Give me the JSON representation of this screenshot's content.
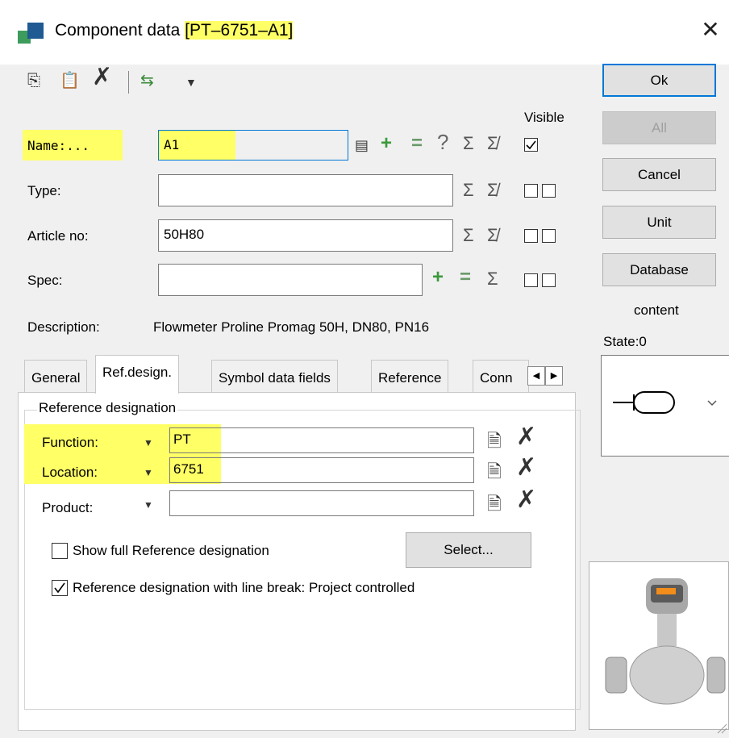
{
  "window": {
    "title_prefix": "Component data",
    "title_highlight": "[PT–6751–A1]"
  },
  "buttons": {
    "ok": "Ok",
    "all": "All",
    "cancel": "Cancel",
    "unit": "Unit",
    "database": "Database",
    "select": "Select..."
  },
  "visible_header": "Visible",
  "content_label": "content",
  "state_label": "State:0",
  "fields": {
    "name": {
      "label": "Name:...",
      "value": "A1"
    },
    "type": {
      "label": "Type:",
      "value": ""
    },
    "article": {
      "label": "Article no:",
      "value": "50H80"
    },
    "spec": {
      "label": "Spec:",
      "value": ""
    },
    "description": {
      "label": "Description:",
      "value": "Flowmeter Proline Promag 50H, DN80, PN16"
    }
  },
  "tabs": [
    "General",
    "Ref.design.",
    "Symbol data fields",
    "Reference",
    "Conn"
  ],
  "refdesig": {
    "group_title": "Reference designation",
    "function": {
      "label": "Function:",
      "value": "PT"
    },
    "location": {
      "label": "Location:",
      "value": "6751"
    },
    "product": {
      "label": "Product:",
      "value": ""
    },
    "show_full": {
      "label": "Show full Reference designation",
      "checked": false
    },
    "line_break": {
      "label": "Reference designation with line break: Project controlled",
      "checked": true
    }
  },
  "colors": {
    "highlight": "#ffff66",
    "accent": "#0078d7"
  }
}
